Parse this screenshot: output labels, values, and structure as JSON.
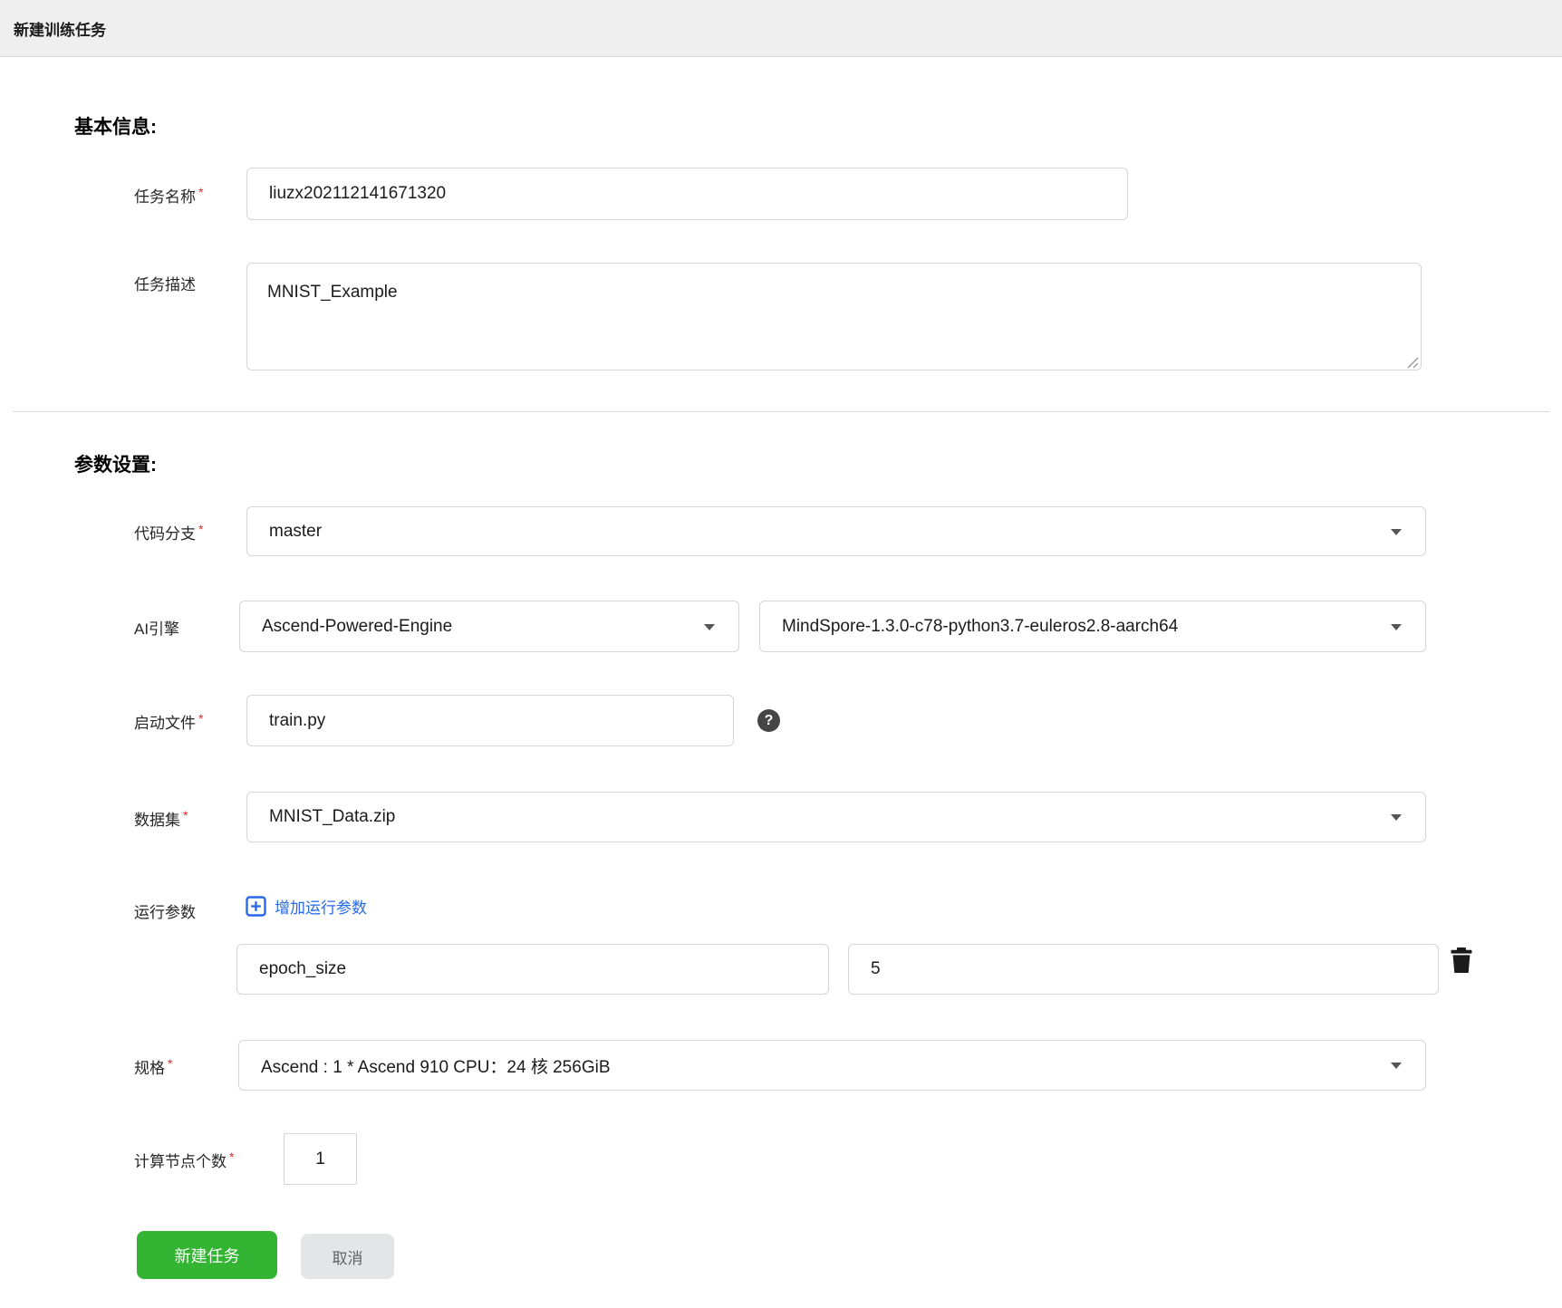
{
  "header": {
    "title": "新建训练任务"
  },
  "sections": {
    "basic_heading": "基本信息:",
    "params_heading": "参数设置:"
  },
  "required_mark": "*",
  "fields": {
    "task_name": {
      "label": "任务名称",
      "required": true,
      "value": "liuzx202112141671320"
    },
    "task_desc": {
      "label": "任务描述",
      "required": false,
      "value": "MNIST_Example"
    },
    "code_branch": {
      "label": "代码分支",
      "required": true,
      "value": "master"
    },
    "ai_engine": {
      "label": "AI引擎",
      "engine": "Ascend-Powered-Engine",
      "version": "MindSpore-1.3.0-c78-python3.7-euleros2.8-aarch64"
    },
    "boot_file": {
      "label": "启动文件",
      "required": true,
      "value": "train.py"
    },
    "dataset": {
      "label": "数据集",
      "required": true,
      "value": "MNIST_Data.zip"
    },
    "run_params": {
      "label": "运行参数",
      "add_link_label": "增加运行参数",
      "entries": [
        {
          "key": "epoch_size",
          "value": "5"
        }
      ]
    },
    "spec": {
      "label": "规格",
      "required": true,
      "value": "Ascend : 1 * Ascend 910 CPU：24 核 256GiB"
    },
    "node_count": {
      "label": "计算节点个数",
      "required": true,
      "value": "1"
    }
  },
  "buttons": {
    "submit": "新建任务",
    "cancel": "取消"
  },
  "icons": {
    "help": "question-circle-icon",
    "add": "plus-square-icon",
    "delete": "trash-icon",
    "dropdown": "caret-down-icon"
  },
  "colors": {
    "header_bg": "#efefef",
    "input_border": "#d6d6d6",
    "link_blue": "#2569e8",
    "required_red": "#e02929",
    "submit_green": "#33b533",
    "cancel_bg": "#e4e5e7",
    "cancel_text": "#606266"
  }
}
